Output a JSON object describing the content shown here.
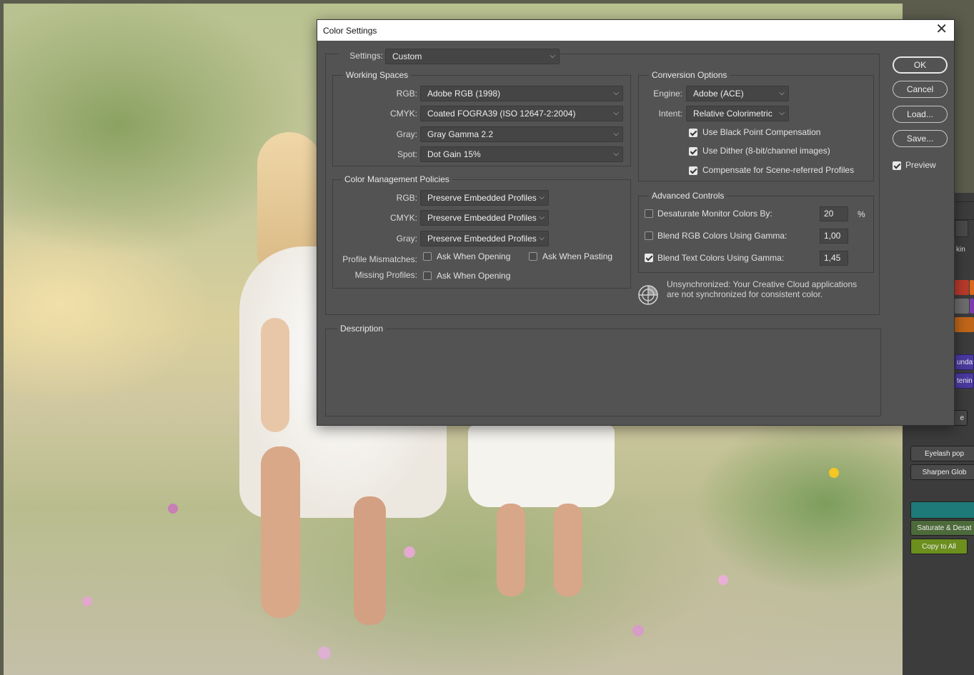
{
  "dialog": {
    "title": "Color Settings",
    "settings": {
      "label": "Settings:",
      "value": "Custom"
    },
    "working_spaces": {
      "title": "Working Spaces",
      "rows": [
        {
          "label": "RGB:",
          "value": "Adobe RGB (1998)"
        },
        {
          "label": "CMYK:",
          "value": "Coated FOGRA39 (ISO 12647-2:2004)"
        },
        {
          "label": "Gray:",
          "value": "Gray Gamma 2.2"
        },
        {
          "label": "Spot:",
          "value": "Dot Gain 15%"
        }
      ]
    },
    "policies": {
      "title": "Color Management Policies",
      "rows": [
        {
          "label": "RGB:",
          "value": "Preserve Embedded Profiles"
        },
        {
          "label": "CMYK:",
          "value": "Preserve Embedded Profiles"
        },
        {
          "label": "Gray:",
          "value": "Preserve Embedded Profiles"
        }
      ],
      "profile_mismatches": {
        "label": "Profile Mismatches:",
        "ask_opening": {
          "label": "Ask When Opening",
          "checked": false
        },
        "ask_pasting": {
          "label": "Ask When Pasting",
          "checked": false
        }
      },
      "missing_profiles": {
        "label": "Missing Profiles:",
        "ask_opening": {
          "label": "Ask When Opening",
          "checked": false
        }
      }
    },
    "conversion": {
      "title": "Conversion Options",
      "engine": {
        "label": "Engine:",
        "value": "Adobe (ACE)"
      },
      "intent": {
        "label": "Intent:",
        "value": "Relative Colorimetric"
      },
      "black_point": {
        "label": "Use Black Point Compensation",
        "checked": true
      },
      "dither": {
        "label": "Use Dither (8-bit/channel images)",
        "checked": true
      },
      "scene_referred": {
        "label": "Compensate for Scene-referred Profiles",
        "checked": true
      }
    },
    "advanced": {
      "title": "Advanced Controls",
      "desaturate": {
        "label": "Desaturate Monitor Colors By:",
        "value": "20",
        "unit": "%",
        "checked": false
      },
      "blend_rgb": {
        "label": "Blend RGB Colors Using Gamma:",
        "value": "1,00",
        "checked": false
      },
      "blend_text": {
        "label": "Blend Text Colors Using Gamma:",
        "value": "1,45",
        "checked": true
      }
    },
    "sync_message": {
      "line1": "Unsynchronized: Your Creative Cloud applications",
      "line2": "are not synchronized for consistent color."
    },
    "description": {
      "title": "Description"
    },
    "buttons": {
      "ok": "OK",
      "cancel": "Cancel",
      "load": "Load...",
      "save": "Save..."
    },
    "preview": {
      "label": "Preview",
      "checked": true
    }
  },
  "side_panel": {
    "partial_labels": [
      "kin",
      "undat",
      "tenin",
      "e"
    ],
    "actions": [
      "Eyelash pop",
      "Sharpen Glob",
      "Saturate & Desat",
      "Copy to All"
    ]
  }
}
